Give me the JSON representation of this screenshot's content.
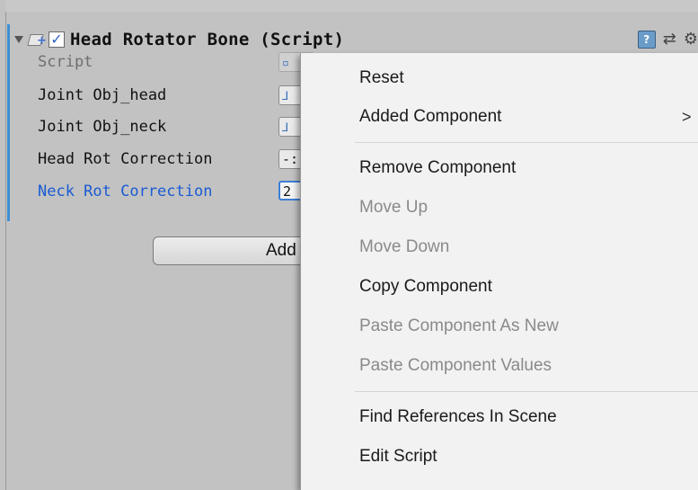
{
  "component": {
    "title": "Head Rotator Bone (Script)",
    "enabled": true,
    "help_icon": "book-help-icon",
    "preset_icon": "preset-icon",
    "settings_icon": "gear-icon"
  },
  "fields": [
    {
      "label": "Script",
      "value": "",
      "state": "disabled"
    },
    {
      "label": "Joint Obj_head",
      "value": "",
      "state": "normal"
    },
    {
      "label": "Joint Obj_neck",
      "value": "",
      "state": "normal"
    },
    {
      "label": "Head Rot Correction",
      "value": "-:",
      "state": "normal"
    },
    {
      "label": "Neck Rot Correction",
      "value": "2",
      "state": "focused"
    }
  ],
  "add_component_label": "Add",
  "context_menu": {
    "items": [
      {
        "label": "Reset",
        "enabled": true
      },
      {
        "label": "Added Component",
        "enabled": true,
        "submenu_arrow": ">"
      },
      {
        "label": "Remove Component",
        "enabled": true
      },
      {
        "label": "Move Up",
        "enabled": false
      },
      {
        "label": "Move Down",
        "enabled": false
      },
      {
        "label": "Copy Component",
        "enabled": true
      },
      {
        "label": "Paste Component As New",
        "enabled": false
      },
      {
        "label": "Paste Component Values",
        "enabled": false
      },
      {
        "label": "Find References In Scene",
        "enabled": true
      },
      {
        "label": "Edit Script",
        "enabled": true
      }
    ]
  },
  "colors": {
    "accent": "#3d8fd6",
    "active_label": "#1a5bd4",
    "panel_bg": "#c2c2c2",
    "menu_bg": "#f2f2f2"
  }
}
